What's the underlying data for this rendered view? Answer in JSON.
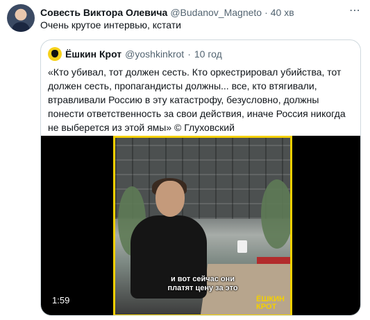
{
  "tweet": {
    "name": "Совесть Виктора Олевича",
    "handle": "@Budanov_Magneto",
    "dot": "·",
    "time": "40 хв",
    "text": "Очень крутое интервью, кстати"
  },
  "quoted": {
    "name": "Ёшкин Крот",
    "handle": "@yoshkinkrot",
    "dot": "·",
    "time": "10 год",
    "text": "«Кто убивал, тот должен сесть. Кто оркестрировал убийства, тот должен сесть, пропагандисты должны... все, кто втягивали, втравливали Россию в эту катастрофу, безусловно, должны понести ответственность за свои действия, иначе Россия никогда не выберется из этой ямы» © Глуховский",
    "video": {
      "subtitle_line1": "и вот сейчас они",
      "subtitle_line2": "платят цену за это",
      "watermark_line1": "ЁШКИН",
      "watermark_line2": "КРОТ",
      "duration": "1:59"
    }
  },
  "icons": {
    "more": "more-icon",
    "avatar": "avatar-icon",
    "mole": "mole-logo-icon"
  },
  "colors": {
    "accent_yellow": "#f4d000",
    "muted": "#536471",
    "border": "#cfd9de"
  }
}
